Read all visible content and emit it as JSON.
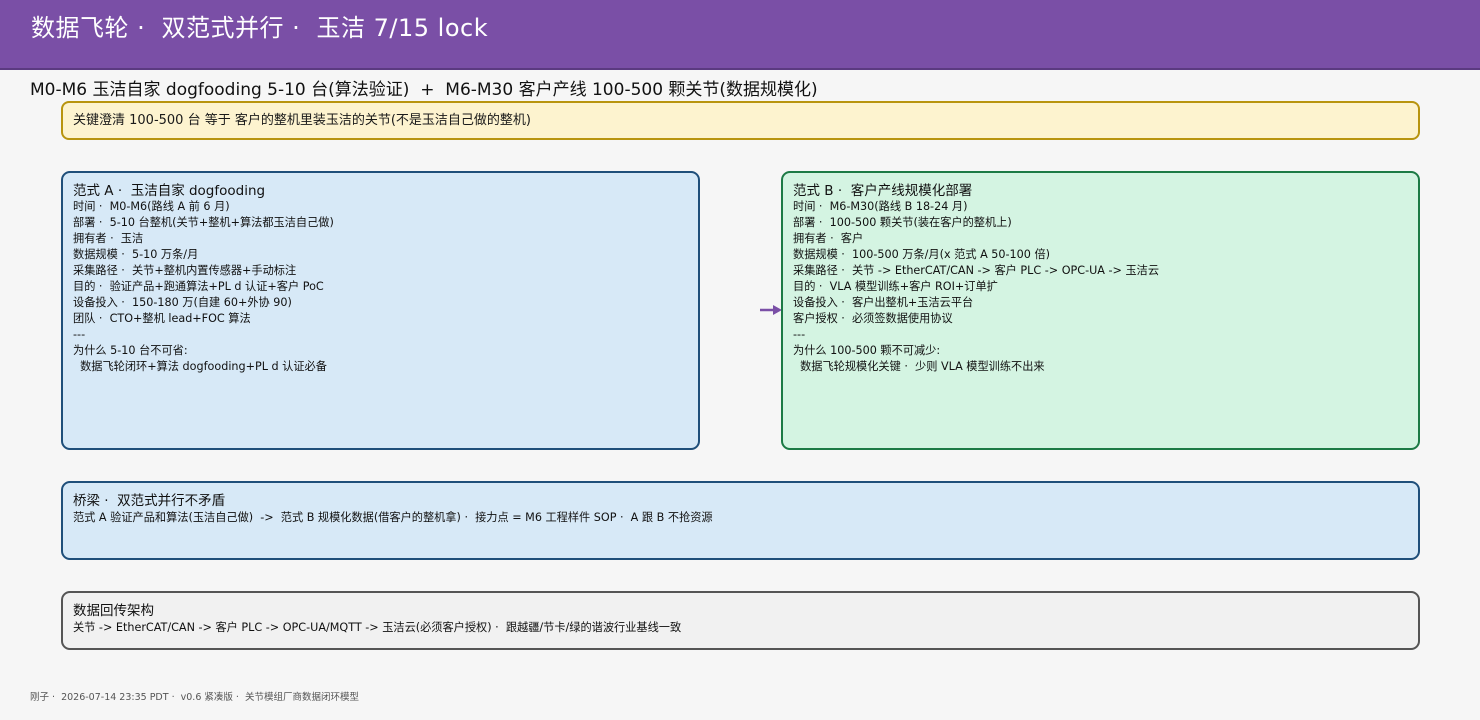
{
  "header": {
    "title": "数据飞轮 ·  双范式并行 ·  玉洁 7/15 lock"
  },
  "subtitle": "M0-M6 玉洁自家 dogfooding 5-10 台(算法验证)  +  M6-M30 客户产线 100-500 颗关节(数据规模化)",
  "note": {
    "text": "关键澄清 100-500 台 等于 客户的整机里装玉洁的关节(不是玉洁自己做的整机)"
  },
  "paradigm_a": {
    "title": "范式 A ·  玉洁自家 dogfooding",
    "lines": [
      "时间 ·  M0-M6(路线 A 前 6 月)",
      "部署 ·  5-10 台整机(关节+整机+算法都玉洁自己做)",
      "拥有者 ·  玉洁",
      "数据规模 ·  5-10 万条/月",
      "采集路径 ·  关节+整机内置传感器+手动标注",
      "目的 ·  验证产品+跑通算法+PL d 认证+客户 PoC",
      "设备投入 ·  150-180 万(自建 60+外协 90)",
      "团队 ·  CTO+整机 lead+FOC 算法",
      "---",
      "为什么 5-10 台不可省:",
      "  数据飞轮闭环+算法 dogfooding+PL d 认证必备"
    ]
  },
  "paradigm_b": {
    "title": "范式 B ·  客户产线规模化部署",
    "lines": [
      "时间 ·  M6-M30(路线 B 18-24 月)",
      "部署 ·  100-500 颗关节(装在客户的整机上)",
      "拥有者 ·  客户",
      "数据规模 ·  100-500 万条/月(x 范式 A 50-100 倍)",
      "采集路径 ·  关节 -> EtherCAT/CAN -> 客户 PLC -> OPC-UA -> 玉洁云",
      "目的 ·  VLA 模型训练+客户 ROI+订单扩",
      "设备投入 ·  客户出整机+玉洁云平台",
      "客户授权 ·  必须签数据使用协议",
      "---",
      "为什么 100-500 颗不可减少:",
      "  数据飞轮规模化关键 ·  少则 VLA 模型训练不出来"
    ]
  },
  "bridge": {
    "title": "桥梁 ·  双范式并行不矛盾",
    "text": "范式 A 验证产品和算法(玉洁自己做)  ->  范式 B 规模化数据(借客户的整机拿) ·  接力点 = M6 工程样件 SOP ·  A 跟 B 不抢资源"
  },
  "architecture": {
    "title": "数据回传架构",
    "text": "关节 -> EtherCAT/CAN -> 客户 PLC -> OPC-UA/MQTT -> 玉洁云(必须客户授权) ·  跟越疆/节卡/绿的谐波行业基线一致"
  },
  "footer": {
    "text": "刚子 ·  2026-07-14 23:35 PDT ·  v0.6 紧凑版 ·  关节模组厂商数据闭环模型"
  },
  "colors": {
    "header": "#7a4fa6",
    "note_bg": "#fdf3cf",
    "box_a_bg": "#d7e9f7",
    "box_b_bg": "#d4f4e2",
    "arrow": "#7a4fa6"
  }
}
